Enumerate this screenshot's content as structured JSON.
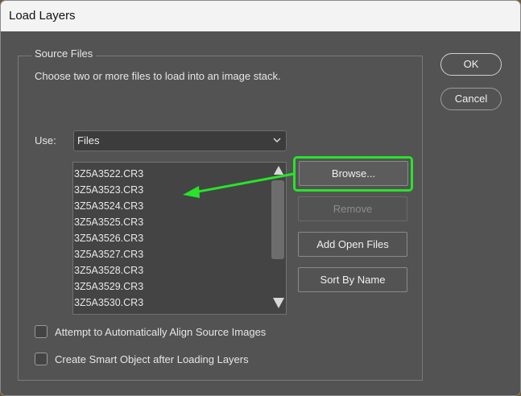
{
  "window": {
    "title": "Load Layers"
  },
  "source_files": {
    "legend": "Source Files",
    "description": "Choose two or more files to load into an image stack.",
    "use_label": "Use:",
    "use_value": "Files",
    "files": [
      "3Z5A3522.CR3",
      "3Z5A3523.CR3",
      "3Z5A3524.CR3",
      "3Z5A3525.CR3",
      "3Z5A3526.CR3",
      "3Z5A3527.CR3",
      "3Z5A3528.CR3",
      "3Z5A3529.CR3",
      "3Z5A3530.CR3"
    ]
  },
  "buttons": {
    "browse": "Browse...",
    "remove": "Remove",
    "add_open": "Add Open Files",
    "sort": "Sort By Name",
    "ok": "OK",
    "cancel": "Cancel"
  },
  "options": {
    "align_label": "Attempt to Automatically Align Source Images",
    "align_checked": false,
    "smart_label": "Create Smart Object after Loading Layers",
    "smart_checked": false
  },
  "colors": {
    "annotation": "#27e32a",
    "panel": "#535353",
    "titlebar": "#f3f3f3"
  },
  "icons": [
    "chevron-down-icon",
    "scroll-up-arrow-icon",
    "scroll-down-arrow-icon",
    "annotation-arrow-icon"
  ]
}
